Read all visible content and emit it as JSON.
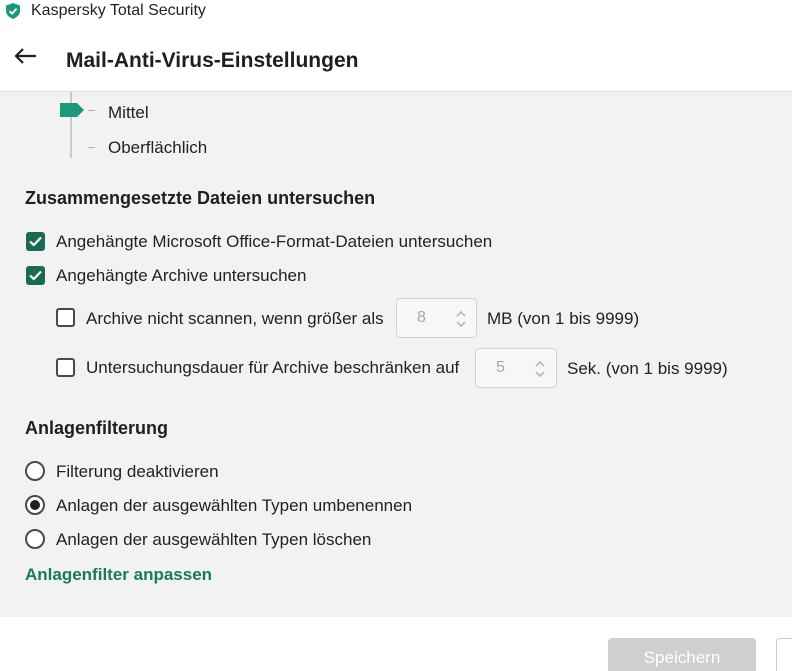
{
  "window": {
    "app_title": "Kaspersky Total Security",
    "shield_icon": "kaspersky-shield-icon",
    "accent_color": "#1a9a7a"
  },
  "header": {
    "back_icon": "arrow-left-icon",
    "title": "Mail-Anti-Virus-Einstellungen"
  },
  "security_level": {
    "items": [
      "Mittel",
      "Oberflächlich"
    ],
    "selected": "Mittel"
  },
  "compound_files": {
    "title": "Zusammengesetzte Dateien untersuchen",
    "scan_office_label": "Angehängte Microsoft Office-Format-Dateien untersuchen",
    "scan_office_checked": true,
    "scan_archives_label": "Angehängte Archive untersuchen",
    "scan_archives_checked": true,
    "skip_large_label": "Archive nicht scannen, wenn größer als",
    "skip_large_checked": false,
    "skip_large_value": "8",
    "skip_large_unit": "MB (von 1 bis 9999)",
    "limit_time_label": "Untersuchungsdauer für Archive beschränken auf",
    "limit_time_checked": false,
    "limit_time_value": "5",
    "limit_time_unit": "Sek. (von 1 bis 9999)"
  },
  "attachment_filter": {
    "title": "Anlagenfilterung",
    "options": [
      "Filterung deaktivieren",
      "Anlagen der ausgewählten Typen umbenennen",
      "Anlagen der ausgewählten Typen löschen"
    ],
    "selected_index": 1,
    "customize_link": "Anlagenfilter anpassen"
  },
  "footer": {
    "save_label": "Speichern"
  }
}
